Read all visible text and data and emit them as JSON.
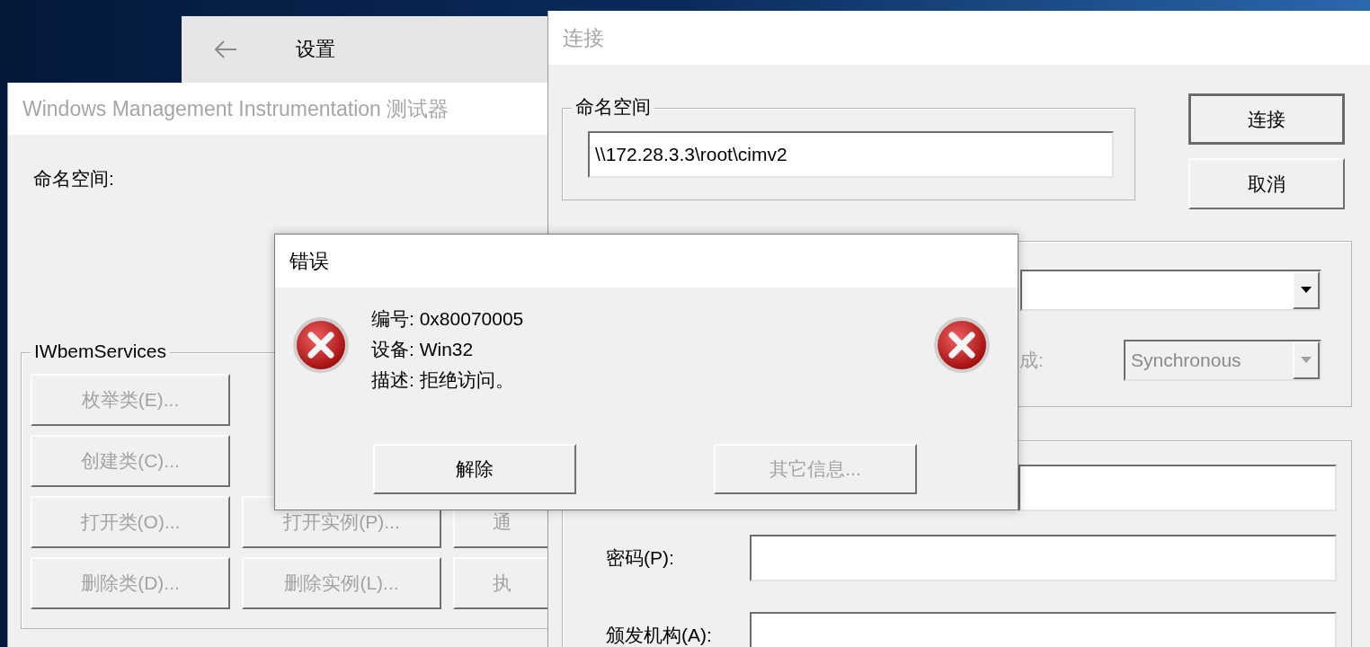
{
  "desktop": {
    "kind": "wallpaper"
  },
  "settings_window": {
    "title": "设置"
  },
  "wmi_window": {
    "title": "Windows Management Instrumentation 测试器",
    "active": false,
    "namespace_label": "命名空间:",
    "group": {
      "title": "IWbemServices",
      "rows": [
        [
          {
            "label": "枚举类(E)...",
            "disabled": true
          }
        ],
        [
          {
            "label": "创建类(C)...",
            "disabled": true
          }
        ],
        [
          {
            "label": "打开类(O)...",
            "disabled": true
          },
          {
            "label": "打开实例(P)...",
            "disabled": true
          },
          {
            "label": "通",
            "disabled": true
          }
        ],
        [
          {
            "label": "删除类(D)...",
            "disabled": true
          },
          {
            "label": "删除实例(L)...",
            "disabled": true
          },
          {
            "label": "执",
            "disabled": true
          }
        ]
      ]
    }
  },
  "connect_window": {
    "title": "连接",
    "active": false,
    "namespace_group": {
      "title": "命名空间",
      "value": "\\\\172.28.3.3\\root\\cimv2"
    },
    "buttons": [
      {
        "label": "连接",
        "default": true
      },
      {
        "label": "取消",
        "default": false
      }
    ],
    "connection_group": {
      "dropdown": {
        "disabled": false
      },
      "partial_label": "成:",
      "mode": {
        "value": "Synchronous",
        "disabled": true
      }
    },
    "credentials": {
      "fields": [
        {
          "kind": "bare"
        },
        {
          "kind": "labeled",
          "label": "密码(P):"
        },
        {
          "kind": "labeled",
          "label": "颁发机构(A):"
        }
      ]
    }
  },
  "error_dialog": {
    "title": "错误",
    "active": true,
    "lines": [
      "编号: 0x80070005",
      "设备: Win32",
      "描述: 拒绝访问。"
    ],
    "buttons": [
      {
        "label": "解除",
        "disabled": false
      },
      {
        "label": "其它信息...",
        "disabled": true
      }
    ]
  }
}
